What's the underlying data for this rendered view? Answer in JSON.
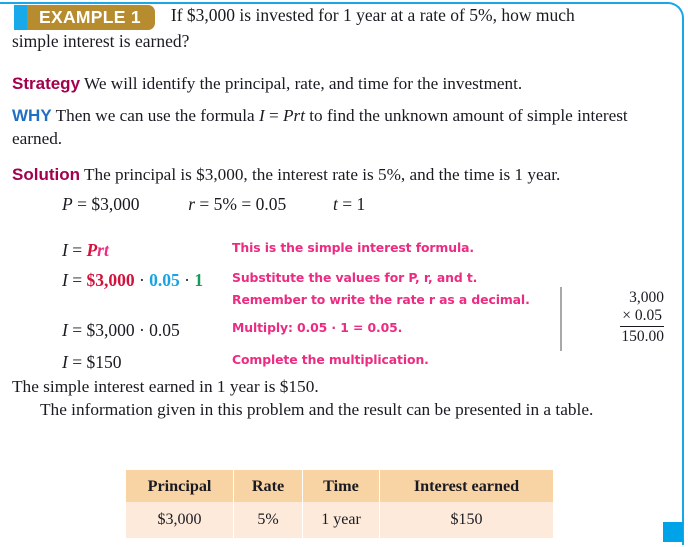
{
  "page": {
    "frame_color": "#1ba6e8",
    "end_marker_color": "#00a3e8"
  },
  "example": {
    "badge_label": "EXAMPLE 1",
    "badge_bg": "#b78c2f",
    "badge_edge": "#17a9ea",
    "question_line1": "If $3,000 is invested for 1 year at a rate of 5%, how much",
    "question_line2": "simple interest is earned?"
  },
  "strategy": {
    "label": "Strategy",
    "label_color": "#a3004d",
    "text": "We will identify the principal, rate, and time for the investment."
  },
  "why": {
    "label": "WHY",
    "label_color": "#1f6fc4",
    "text_before": "Then we can use the formula",
    "formula_I": "I",
    "formula_eq": "=",
    "formula_prt": "Prt",
    "text_after": "to find the unknown amount of simple interest earned."
  },
  "solution": {
    "label": "Solution",
    "label_color": "#a3004d",
    "text": "The principal is $3,000, the interest rate is 5%, and the time is 1 year."
  },
  "work": {
    "givens": {
      "p_var": "P",
      "p_eq": "=",
      "p_val": "$3,000",
      "r_var": "r",
      "r_eq1": "=",
      "r_pct": "5%",
      "r_eq2": "=",
      "r_dec": "0.05",
      "t_var": "t",
      "t_eq": "=",
      "t_val": "1"
    },
    "rows": [
      {
        "lhs_var": "I",
        "lhs_eq": "=",
        "rhs_parts": [
          {
            "text": "P",
            "color": "#d1123c"
          },
          {
            "text": "rt",
            "color": "#ec2c82"
          }
        ],
        "annotation": "This is the simple interest formula."
      },
      {
        "lhs_var": "I",
        "lhs_eq": "=",
        "rhs_parts": [
          {
            "text": "$3,000",
            "color": "#d1123c"
          },
          {
            "text": " · ",
            "color": "#1a1a22"
          },
          {
            "text": "0.05",
            "color": "#1aa3e0"
          },
          {
            "text": " · ",
            "color": "#1a1a22"
          },
          {
            "text": "1",
            "color": "#179a5a"
          }
        ],
        "annotation": "Substitute the values for P, r, and t.",
        "annotation2": "Remember to write the rate r as a decimal."
      },
      {
        "lhs_var": "I",
        "lhs_eq": "=",
        "plain_rhs": "$3,000 · 0.05",
        "annotation": "Multiply: 0.05 · 1 = 0.05."
      },
      {
        "lhs_var": "I",
        "lhs_eq": "=",
        "plain_rhs": "$150",
        "annotation": "Complete the multiplication."
      }
    ]
  },
  "sidecalc": {
    "multiplicand": "3,000",
    "multiplier": "× 0.05",
    "product": "150.00",
    "divider_color": "#a9a9a9"
  },
  "closing": {
    "earned": "The simple interest earned in 1 year is $150.",
    "info": "The information given in this problem and the result can be presented in a table."
  },
  "table": {
    "header_bg": "#f8d4a5",
    "body_bg": "#fdeada",
    "headers": [
      "Principal",
      "Rate",
      "Time",
      "Interest earned"
    ],
    "rows": [
      [
        "$3,000",
        "5%",
        "1 year",
        "$150"
      ]
    ]
  }
}
